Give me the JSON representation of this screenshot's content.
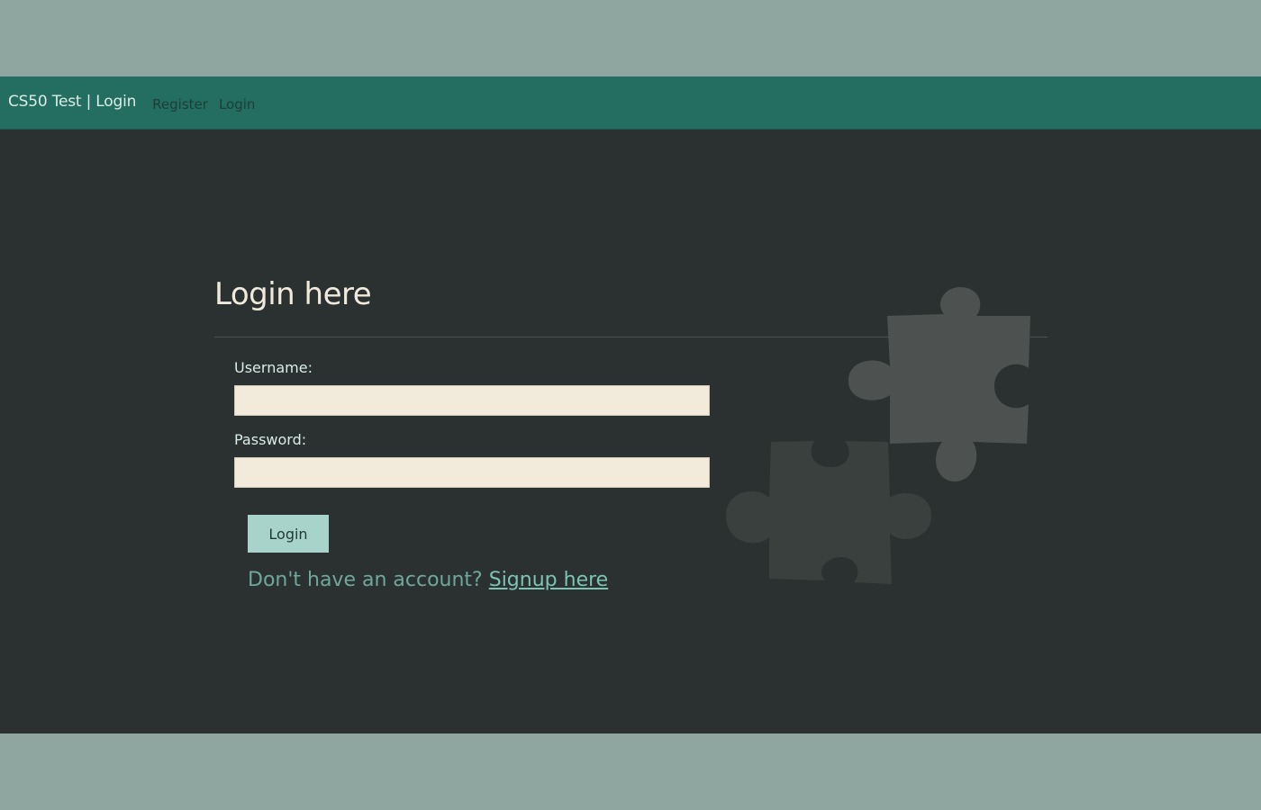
{
  "navbar": {
    "brand": "CS50 Test | Login",
    "links": [
      {
        "label": "Register"
      },
      {
        "label": "Login"
      }
    ]
  },
  "page": {
    "title": "Login here"
  },
  "form": {
    "username_label": "Username:",
    "username_value": "",
    "password_label": "Password:",
    "password_value": "",
    "submit_label": "Login"
  },
  "signup": {
    "prompt": "Don't have an account?",
    "link_label": "Signup here"
  },
  "decoration": {
    "image": "puzzle-pieces-icon"
  },
  "colors": {
    "navbar": "#246d61",
    "background": "#2b3131",
    "outer": "#8fa5a0",
    "input": "#f2eadb",
    "button": "#a8d3ca",
    "link": "#7cc3b3"
  }
}
